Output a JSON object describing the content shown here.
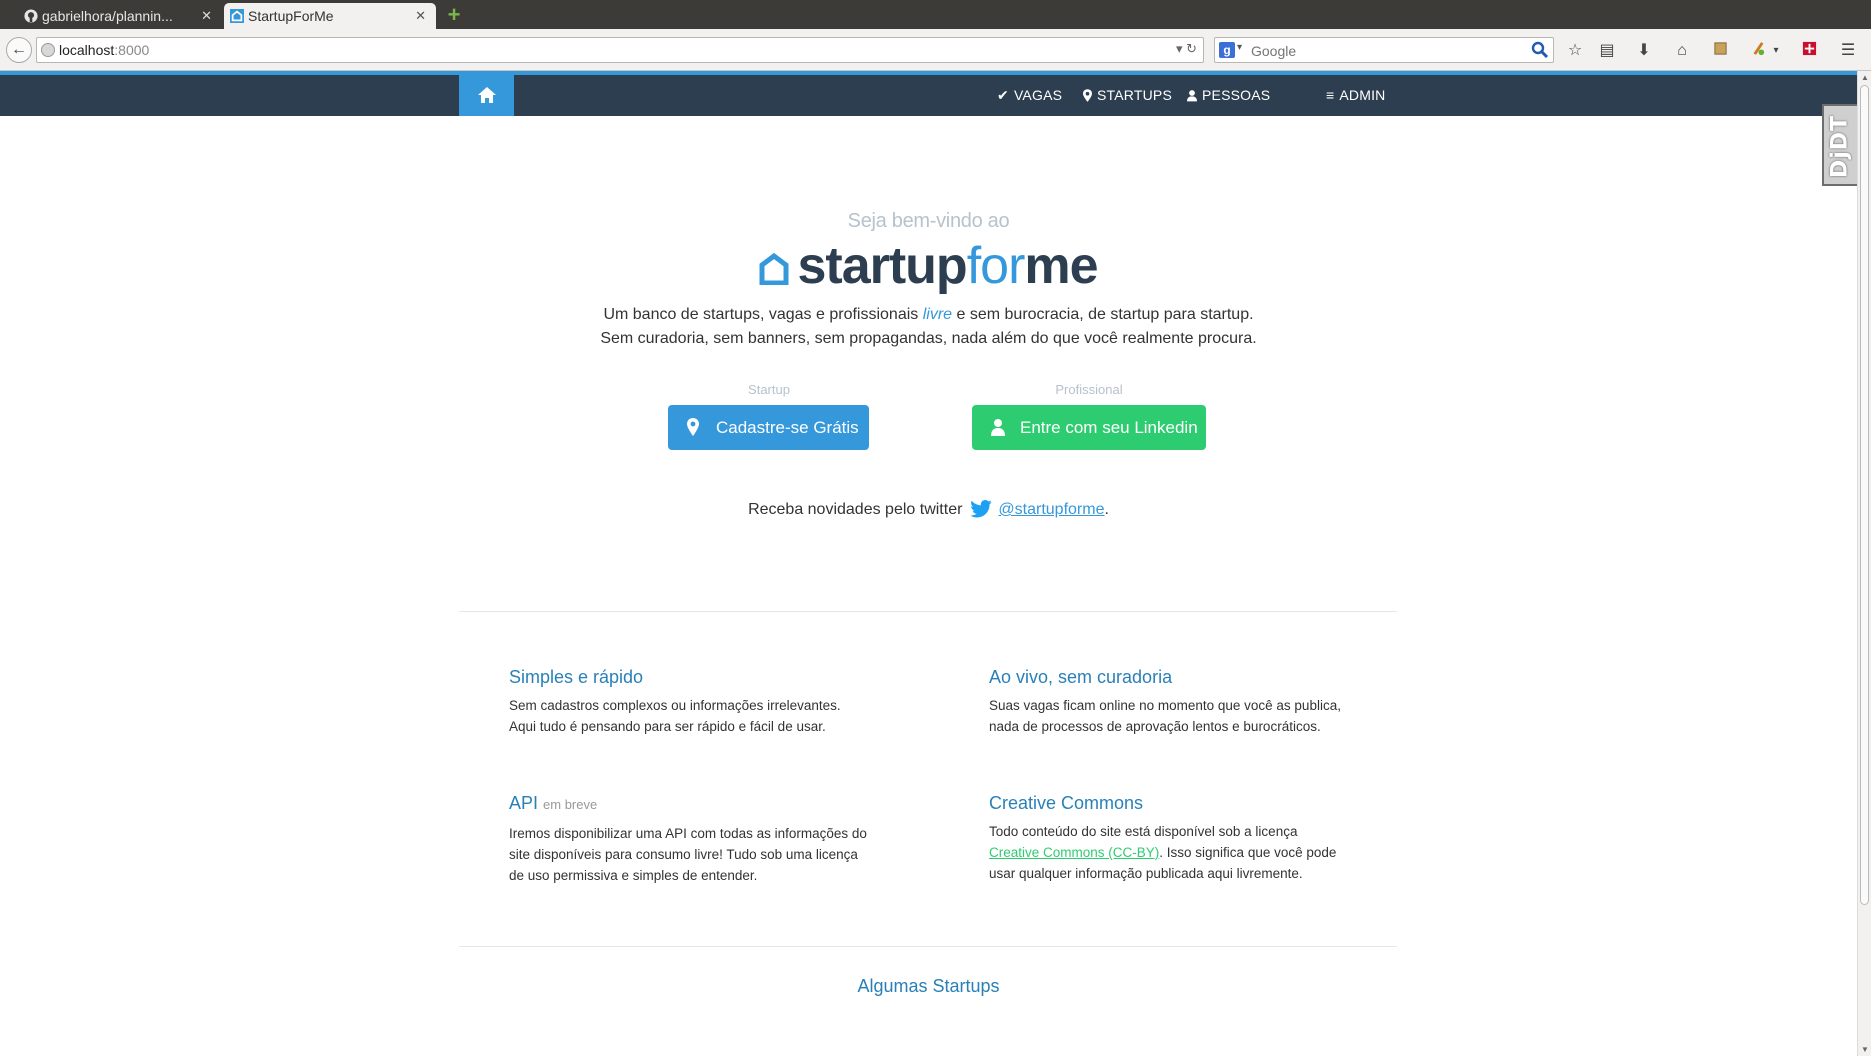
{
  "browser": {
    "tabs": [
      {
        "title": "gabrielhora/plannin...",
        "active": false
      },
      {
        "title": "StartupForMe",
        "active": true
      }
    ],
    "url_host": "localhost",
    "url_port": ":8000",
    "search_placeholder": "Google"
  },
  "nav": {
    "items": [
      {
        "label": "VAGAS",
        "icon": "check-icon"
      },
      {
        "label": "STARTUPS",
        "icon": "map-marker-icon"
      },
      {
        "label": "PESSOAS",
        "icon": "user-icon"
      },
      {
        "label": "ADMIN",
        "icon": "menu-icon"
      }
    ]
  },
  "hero": {
    "welcome": "Seja bem-vindo ao",
    "brand": {
      "part1": "startup",
      "part2": "for",
      "part3": "me"
    },
    "tagline_line1_before": "Um banco de startups, vagas e profissionais ",
    "tagline_line1_em": "livre",
    "tagline_line1_after": " e sem burocracia, de startup para startup.",
    "tagline_line2": "Sem curadoria, sem banners, sem propagandas, nada além do que você realmente procura."
  },
  "cta": {
    "startup_label": "Startup",
    "startup_button": "Cadastre-se Grátis",
    "profissional_label": "Profissional",
    "profissional_button": "Entre com seu Linkedin"
  },
  "twitter": {
    "text": "Receba novidades pelo twitter",
    "handle": "@startupforme",
    "suffix": "."
  },
  "features": [
    {
      "title": "Simples e rápido",
      "text": "Sem cadastros complexos ou informações irrelevantes. Aqui tudo é pensando para ser rápido e fácil de usar."
    },
    {
      "title": "Ao vivo, sem curadoria",
      "text": "Suas vagas ficam online no momento que você as publica, nada de processos de aprovação lentos e burocráticos."
    },
    {
      "title": "API",
      "title_small": "em breve",
      "text": "Iremos disponibilizar uma API com todas as informações do site disponíveis para consumo livre! Tudo sob uma licença de uso permissiva e simples de entender."
    },
    {
      "title": "Creative Commons",
      "text_before": "Todo conteúdo do site está disponível sob a licença ",
      "link": "Creative Commons (CC-BY)",
      "text_after": ". Isso significa que você pode usar qualquer informação publicada aqui livremente."
    }
  ],
  "section": {
    "title": "Algumas Startups"
  },
  "colors": {
    "navy": "#2c3e50",
    "blue": "#3498db",
    "green": "#2ecc71",
    "link": "#2980b9"
  }
}
